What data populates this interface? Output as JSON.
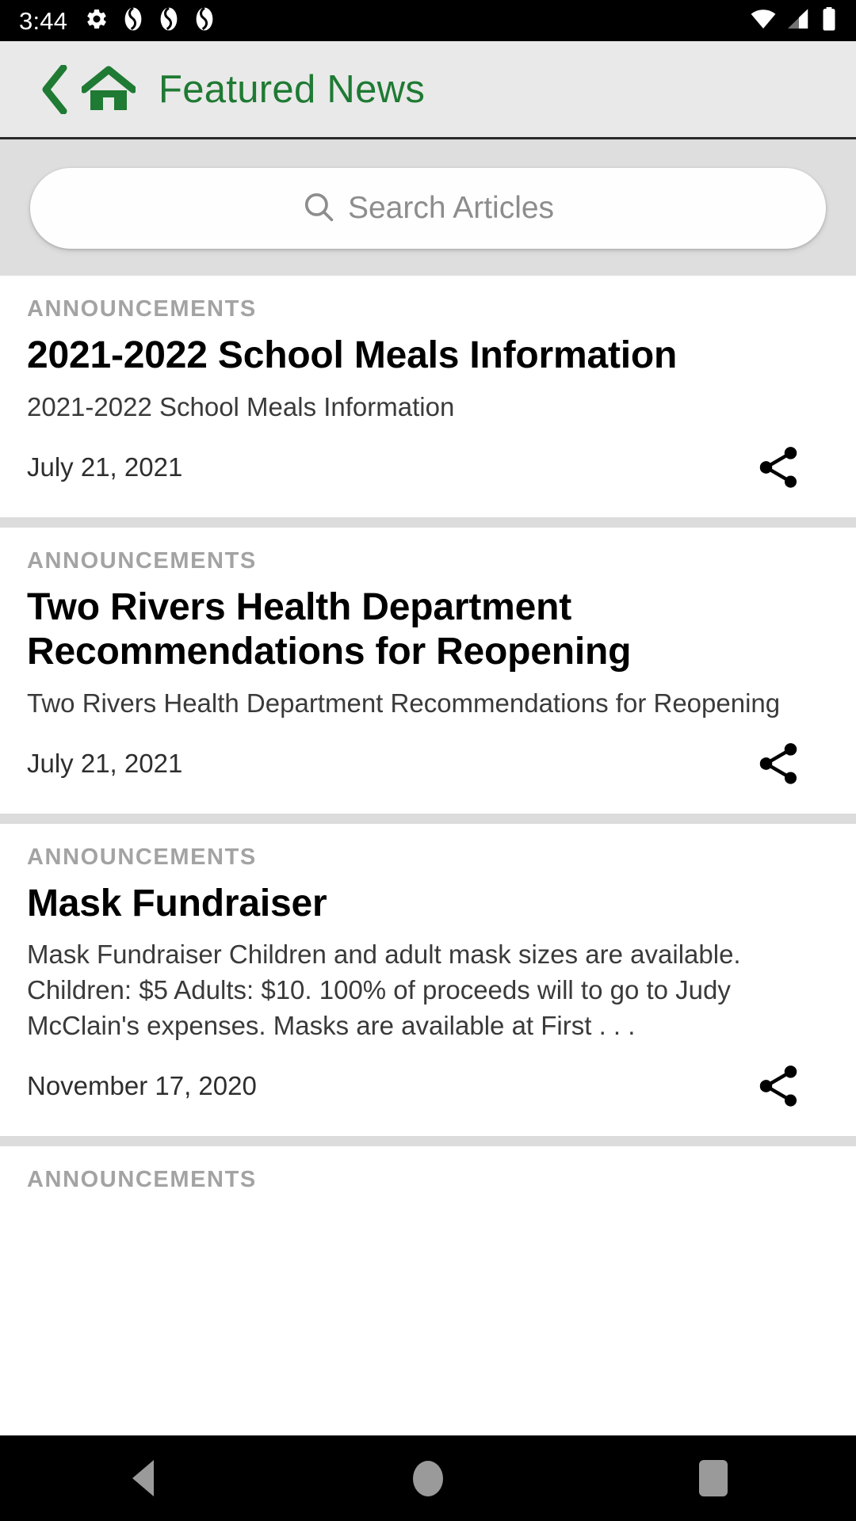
{
  "status_bar": {
    "time": "3:44",
    "left_icons": [
      "gear-icon",
      "swirl-icon",
      "swirl-icon",
      "swirl-icon"
    ],
    "right_icons": [
      "wifi-icon",
      "cellular-signal-icon",
      "battery-icon"
    ]
  },
  "header": {
    "back_icon": "chevron-left-icon",
    "home_icon": "home-icon",
    "title": "Featured News",
    "accent_color": "#1f7a33"
  },
  "search": {
    "icon": "search-icon",
    "placeholder": "Search Articles",
    "value": ""
  },
  "articles": [
    {
      "category": "ANNOUNCEMENTS",
      "title": "2021-2022 School Meals Information",
      "summary": "2021-2022 School Meals Information",
      "date": "July 21, 2021",
      "share_icon": "share-icon"
    },
    {
      "category": "ANNOUNCEMENTS",
      "title": "Two Rivers Health Department Recommendations for Reopening",
      "summary": "Two Rivers Health Department Recommendations for Reopening",
      "date": "July 21, 2021",
      "share_icon": "share-icon"
    },
    {
      "category": "ANNOUNCEMENTS",
      "title": "Mask Fundraiser",
      "summary": "Mask Fundraiser Children and adult mask sizes are available. Children: $5 Adults: $10. 100% of proceeds will to go to Judy McClain's expenses.  Masks are available at First . . .",
      "date": "November 17, 2020",
      "share_icon": "share-icon"
    },
    {
      "category": "ANNOUNCEMENTS",
      "title": "",
      "summary": "",
      "date": "",
      "share_icon": "share-icon"
    }
  ],
  "nav_bar": {
    "back_label": "back-button",
    "home_label": "home-button",
    "recents_label": "recents-button"
  }
}
